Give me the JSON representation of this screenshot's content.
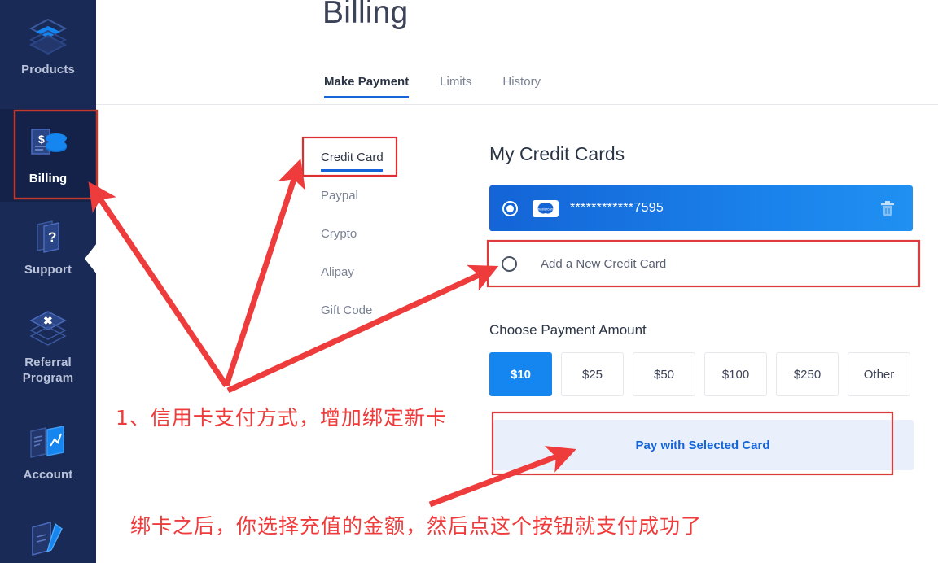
{
  "sidebar": {
    "items": [
      {
        "label": "Products",
        "icon": "layers-cube-icon",
        "active": false
      },
      {
        "label": "Billing",
        "icon": "invoice-coins-icon",
        "active": true
      },
      {
        "label": "Support",
        "icon": "question-cards-icon",
        "active": false
      },
      {
        "label": "Referral Program",
        "icon": "layers-star-icon",
        "active": false
      },
      {
        "label": "Account",
        "icon": "folder-chart-icon",
        "active": false
      },
      {
        "label": "",
        "icon": "notebook-pencil-icon",
        "active": false
      }
    ]
  },
  "header": {
    "title": "Billing",
    "tabs": [
      {
        "label": "Make Payment",
        "active": true
      },
      {
        "label": "Limits",
        "active": false
      },
      {
        "label": "History",
        "active": false
      }
    ]
  },
  "methods": [
    {
      "label": "Credit Card",
      "active": true
    },
    {
      "label": "Paypal",
      "active": false
    },
    {
      "label": "Crypto",
      "active": false
    },
    {
      "label": "Alipay",
      "active": false
    },
    {
      "label": "Gift Code",
      "active": false
    }
  ],
  "cards": {
    "title": "My Credit Cards",
    "saved_card": {
      "number": "************7595",
      "brand_icon": "mastercard-icon",
      "selected": true,
      "delete_icon": "trash-icon"
    },
    "add_new_label": "Add a New Credit Card"
  },
  "payment": {
    "amount_title": "Choose Payment Amount",
    "amounts": [
      {
        "label": "$10",
        "selected": true
      },
      {
        "label": "$25",
        "selected": false
      },
      {
        "label": "$50",
        "selected": false
      },
      {
        "label": "$100",
        "selected": false
      },
      {
        "label": "$250",
        "selected": false
      },
      {
        "label": "Other",
        "selected": false
      }
    ],
    "pay_button_label": "Pay with Selected Card"
  },
  "annotations": {
    "note_1": "1、信用卡支付方式，增加绑定新卡",
    "note_2": "绑卡之后，你选择充值的金额，然后点这个按钮就支付成功了"
  },
  "colors": {
    "sidebar_bg": "#192a56",
    "accent_blue": "#1565d8",
    "card_blue": "#1585f0",
    "annotation_red": "#ef3b3b"
  }
}
